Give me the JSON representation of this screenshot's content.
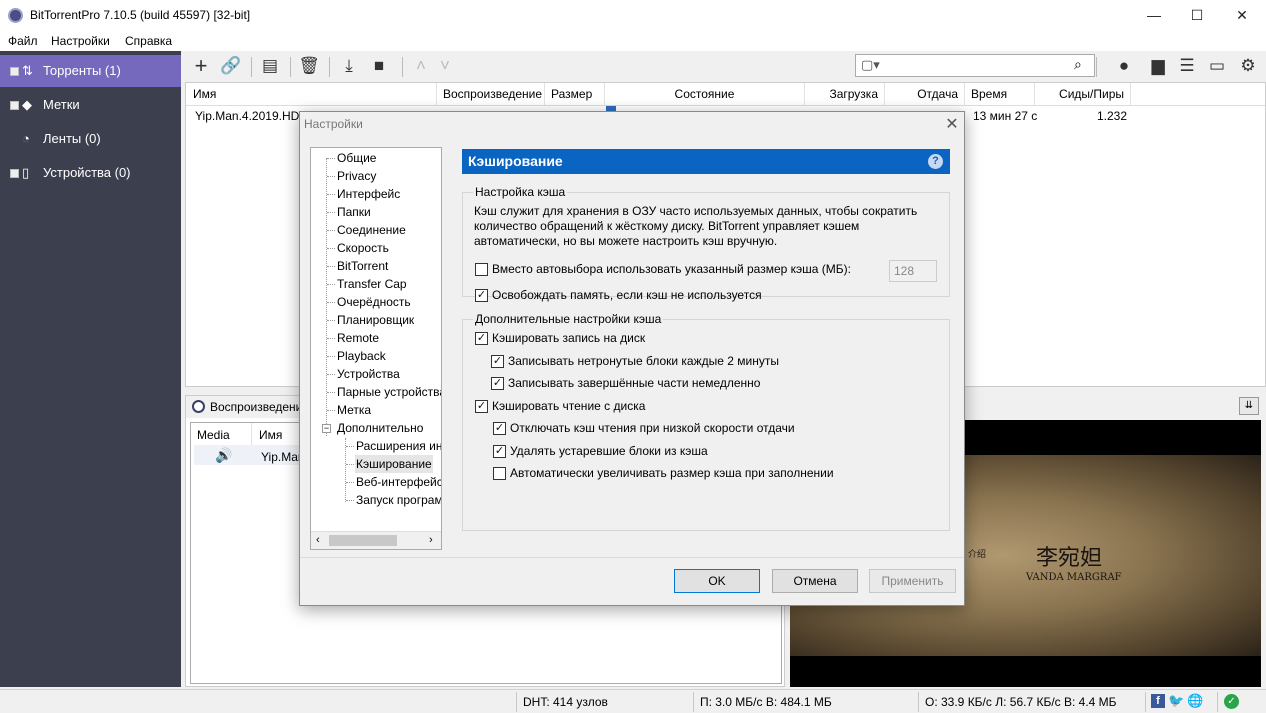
{
  "window": {
    "title": "BitTorrentPro 7.10.5  (build 45597) [32-bit]",
    "minimize_glyph": "—",
    "maximize_glyph": "☐",
    "close_glyph": "✕"
  },
  "menubar": {
    "file": "Файл",
    "settings": "Настройки",
    "help": "Справка"
  },
  "sidebar": {
    "items": [
      {
        "label": "Торренты (1)",
        "icon": "torrents-icon"
      },
      {
        "label": "Метки",
        "icon": "tag-icon"
      },
      {
        "label": "Ленты (0)",
        "icon": "rss-icon"
      },
      {
        "label": "Устройства (0)",
        "icon": "device-icon"
      }
    ]
  },
  "columns": {
    "name": "Имя",
    "playback": "Воспроизведение",
    "size": "Размер",
    "status": "Состояние",
    "download": "Загрузка",
    "upload": "Отдача",
    "time": "Время",
    "seeds": "Сиды/Пиры"
  },
  "torrent": {
    "name": "Yip.Man.4.2019.HDR",
    "time": "13 мин 27 с",
    "seeds": "1.232"
  },
  "bottom": {
    "tab_label": "Воспроизведени",
    "col_media": "Media",
    "col_name": "Имя",
    "row_name": "Yip.Man"
  },
  "video": {
    "caption_cn": "李宛妲",
    "caption_en": "VANDA MARGRAF",
    "small_cn": "介绍"
  },
  "statusbar": {
    "dht": "DHT: 414 узлов",
    "download": "П: 3.0 МБ/с В: 484.1 МБ",
    "upload": "О: 33.9 КБ/с Л: 56.7 КБ/с В: 4.4 МБ"
  },
  "dialog": {
    "title": "Настройки",
    "close_glyph": "✕",
    "tree": [
      {
        "label": "Общие"
      },
      {
        "label": "Privacy"
      },
      {
        "label": "Интерфейс"
      },
      {
        "label": "Папки"
      },
      {
        "label": "Соединение"
      },
      {
        "label": "Скорость"
      },
      {
        "label": "BitTorrent"
      },
      {
        "label": "Transfer Cap"
      },
      {
        "label": "Очерёдность"
      },
      {
        "label": "Планировщик"
      },
      {
        "label": "Remote"
      },
      {
        "label": "Playback"
      },
      {
        "label": "Устройства"
      },
      {
        "label": "Парные устройства"
      },
      {
        "label": "Метка"
      },
      {
        "label": "Дополнительно"
      },
      {
        "label": "Расширения ин"
      },
      {
        "label": "Кэширование"
      },
      {
        "label": "Веб-интерфейс"
      },
      {
        "label": "Запуск програм"
      }
    ],
    "panel_title": "Кэширование",
    "help_glyph": "?",
    "group1_title": "Настройка кэша",
    "desc_line1": "Кэш служит для хранения в ОЗУ часто используемых данных, чтобы сократить",
    "desc_line2": "количество обращений к жёсткому диску. BitTorrent управляет кэшем",
    "desc_line3": "автоматически, но вы можете настроить кэш вручную.",
    "opt_override": "Вместо автовыбора использовать указанный размер кэша (МБ):",
    "cache_size": "128",
    "opt_free_mem": "Освобождать память, если кэш не используется",
    "group2_title": "Дополнительные настройки кэша",
    "opt_cache_write": "Кэшировать запись на диск",
    "opt_write_untouched": "Записывать нетронутые блоки каждые 2 минуты",
    "opt_write_finished": "Записывать завершённые части немедленно",
    "opt_cache_read": "Кэшировать чтение с диска",
    "opt_disable_read_slow": "Отключать кэш чтения при низкой скорости отдачи",
    "opt_remove_old": "Удалять устаревшие блоки из кэша",
    "opt_auto_increase": "Автоматически увеличивать размер кэша при заполнении",
    "ok": "OK",
    "cancel": "Отмена",
    "apply": "Применить"
  },
  "colors": {
    "sidebar_bg": "#3c3f4e",
    "sidebar_selected": "#7569be",
    "panel_header": "#0a64c2"
  }
}
